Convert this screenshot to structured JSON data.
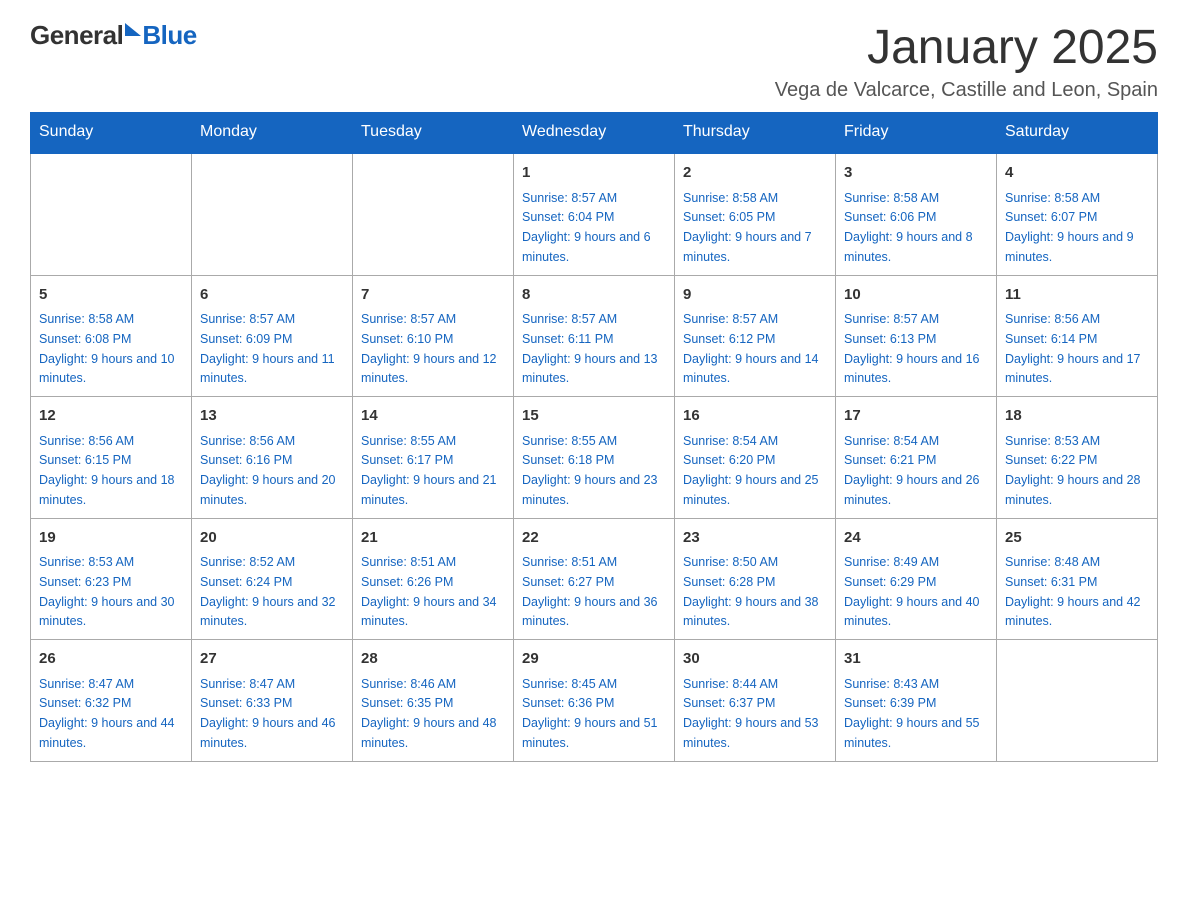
{
  "header": {
    "logo_general": "General",
    "logo_blue": "Blue",
    "month_title": "January 2025",
    "location": "Vega de Valcarce, Castille and Leon, Spain"
  },
  "days_of_week": [
    "Sunday",
    "Monday",
    "Tuesday",
    "Wednesday",
    "Thursday",
    "Friday",
    "Saturday"
  ],
  "weeks": [
    [
      {
        "day": "",
        "info": ""
      },
      {
        "day": "",
        "info": ""
      },
      {
        "day": "",
        "info": ""
      },
      {
        "day": "1",
        "info": "Sunrise: 8:57 AM\nSunset: 6:04 PM\nDaylight: 9 hours and 6 minutes."
      },
      {
        "day": "2",
        "info": "Sunrise: 8:58 AM\nSunset: 6:05 PM\nDaylight: 9 hours and 7 minutes."
      },
      {
        "day": "3",
        "info": "Sunrise: 8:58 AM\nSunset: 6:06 PM\nDaylight: 9 hours and 8 minutes."
      },
      {
        "day": "4",
        "info": "Sunrise: 8:58 AM\nSunset: 6:07 PM\nDaylight: 9 hours and 9 minutes."
      }
    ],
    [
      {
        "day": "5",
        "info": "Sunrise: 8:58 AM\nSunset: 6:08 PM\nDaylight: 9 hours and 10 minutes."
      },
      {
        "day": "6",
        "info": "Sunrise: 8:57 AM\nSunset: 6:09 PM\nDaylight: 9 hours and 11 minutes."
      },
      {
        "day": "7",
        "info": "Sunrise: 8:57 AM\nSunset: 6:10 PM\nDaylight: 9 hours and 12 minutes."
      },
      {
        "day": "8",
        "info": "Sunrise: 8:57 AM\nSunset: 6:11 PM\nDaylight: 9 hours and 13 minutes."
      },
      {
        "day": "9",
        "info": "Sunrise: 8:57 AM\nSunset: 6:12 PM\nDaylight: 9 hours and 14 minutes."
      },
      {
        "day": "10",
        "info": "Sunrise: 8:57 AM\nSunset: 6:13 PM\nDaylight: 9 hours and 16 minutes."
      },
      {
        "day": "11",
        "info": "Sunrise: 8:56 AM\nSunset: 6:14 PM\nDaylight: 9 hours and 17 minutes."
      }
    ],
    [
      {
        "day": "12",
        "info": "Sunrise: 8:56 AM\nSunset: 6:15 PM\nDaylight: 9 hours and 18 minutes."
      },
      {
        "day": "13",
        "info": "Sunrise: 8:56 AM\nSunset: 6:16 PM\nDaylight: 9 hours and 20 minutes."
      },
      {
        "day": "14",
        "info": "Sunrise: 8:55 AM\nSunset: 6:17 PM\nDaylight: 9 hours and 21 minutes."
      },
      {
        "day": "15",
        "info": "Sunrise: 8:55 AM\nSunset: 6:18 PM\nDaylight: 9 hours and 23 minutes."
      },
      {
        "day": "16",
        "info": "Sunrise: 8:54 AM\nSunset: 6:20 PM\nDaylight: 9 hours and 25 minutes."
      },
      {
        "day": "17",
        "info": "Sunrise: 8:54 AM\nSunset: 6:21 PM\nDaylight: 9 hours and 26 minutes."
      },
      {
        "day": "18",
        "info": "Sunrise: 8:53 AM\nSunset: 6:22 PM\nDaylight: 9 hours and 28 minutes."
      }
    ],
    [
      {
        "day": "19",
        "info": "Sunrise: 8:53 AM\nSunset: 6:23 PM\nDaylight: 9 hours and 30 minutes."
      },
      {
        "day": "20",
        "info": "Sunrise: 8:52 AM\nSunset: 6:24 PM\nDaylight: 9 hours and 32 minutes."
      },
      {
        "day": "21",
        "info": "Sunrise: 8:51 AM\nSunset: 6:26 PM\nDaylight: 9 hours and 34 minutes."
      },
      {
        "day": "22",
        "info": "Sunrise: 8:51 AM\nSunset: 6:27 PM\nDaylight: 9 hours and 36 minutes."
      },
      {
        "day": "23",
        "info": "Sunrise: 8:50 AM\nSunset: 6:28 PM\nDaylight: 9 hours and 38 minutes."
      },
      {
        "day": "24",
        "info": "Sunrise: 8:49 AM\nSunset: 6:29 PM\nDaylight: 9 hours and 40 minutes."
      },
      {
        "day": "25",
        "info": "Sunrise: 8:48 AM\nSunset: 6:31 PM\nDaylight: 9 hours and 42 minutes."
      }
    ],
    [
      {
        "day": "26",
        "info": "Sunrise: 8:47 AM\nSunset: 6:32 PM\nDaylight: 9 hours and 44 minutes."
      },
      {
        "day": "27",
        "info": "Sunrise: 8:47 AM\nSunset: 6:33 PM\nDaylight: 9 hours and 46 minutes."
      },
      {
        "day": "28",
        "info": "Sunrise: 8:46 AM\nSunset: 6:35 PM\nDaylight: 9 hours and 48 minutes."
      },
      {
        "day": "29",
        "info": "Sunrise: 8:45 AM\nSunset: 6:36 PM\nDaylight: 9 hours and 51 minutes."
      },
      {
        "day": "30",
        "info": "Sunrise: 8:44 AM\nSunset: 6:37 PM\nDaylight: 9 hours and 53 minutes."
      },
      {
        "day": "31",
        "info": "Sunrise: 8:43 AM\nSunset: 6:39 PM\nDaylight: 9 hours and 55 minutes."
      },
      {
        "day": "",
        "info": ""
      }
    ]
  ]
}
